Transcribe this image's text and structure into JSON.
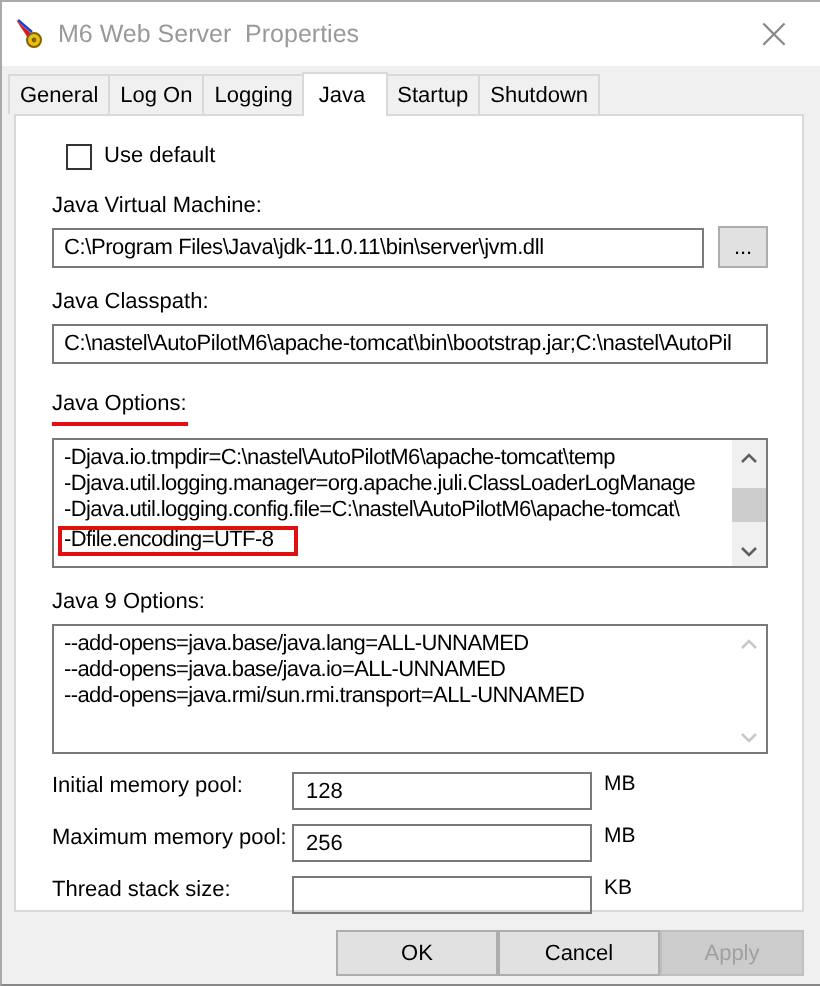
{
  "window": {
    "title": "M6 Web Server  Properties",
    "close": "×"
  },
  "tabs": [
    {
      "label": "General",
      "selected": false
    },
    {
      "label": "Log On",
      "selected": false
    },
    {
      "label": "Logging",
      "selected": false
    },
    {
      "label": "Java",
      "selected": true
    },
    {
      "label": "Startup",
      "selected": false
    },
    {
      "label": "Shutdown",
      "selected": false
    }
  ],
  "use_default": {
    "label": "Use default",
    "checked": false
  },
  "jvm": {
    "label": "Java Virtual Machine:",
    "value": "C:\\Program Files\\Java\\jdk-11.0.11\\bin\\server\\jvm.dll",
    "browse": "..."
  },
  "classpath": {
    "label": "Java Classpath:",
    "value": "C:\\nastel\\AutoPilotM6\\apache-tomcat\\bin\\bootstrap.jar;C:\\nastel\\AutoPil"
  },
  "java_options": {
    "label": "Java Options:",
    "underlined": true,
    "lines": [
      {
        "text": "-Djava.io.tmpdir=C:\\nastel\\AutoPilotM6\\apache-tomcat\\temp",
        "highlighted": false
      },
      {
        "text": "-Djava.util.logging.manager=org.apache.juli.ClassLoaderLogManage",
        "highlighted": false
      },
      {
        "text": "-Djava.util.logging.config.file=C:\\nastel\\AutoPilotM6\\apache-tomcat\\",
        "highlighted": false
      },
      {
        "text": "-Dfile.encoding=UTF-8",
        "highlighted": true
      }
    ]
  },
  "java9_options": {
    "label": "Java 9 Options:",
    "lines": [
      "--add-opens=java.base/java.lang=ALL-UNNAMED",
      "--add-opens=java.base/java.io=ALL-UNNAMED",
      "--add-opens=java.rmi/sun.rmi.transport=ALL-UNNAMED"
    ]
  },
  "memory": [
    {
      "label": "Initial memory pool:",
      "value": "128",
      "unit": "MB"
    },
    {
      "label": "Maximum memory pool:",
      "value": "256",
      "unit": "MB"
    },
    {
      "label": "Thread stack size:",
      "unit": "KB"
    }
  ],
  "buttons": [
    {
      "label": "OK",
      "disabled": false
    },
    {
      "label": "Cancel",
      "disabled": false
    },
    {
      "label": "Apply",
      "disabled": true
    }
  ]
}
